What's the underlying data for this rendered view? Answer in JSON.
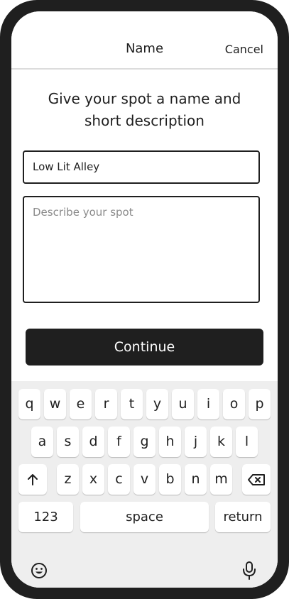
{
  "navbar": {
    "title": "Name",
    "cancel_label": "Cancel"
  },
  "form": {
    "heading_line1": "Give your spot a name and",
    "heading_line2": "short description",
    "name_value": "Low Lit Alley",
    "description_placeholder": "Describe your spot",
    "continue_label": "Continue"
  },
  "keyboard": {
    "row1": [
      "q",
      "w",
      "e",
      "r",
      "t",
      "y",
      "u",
      "i",
      "o",
      "p"
    ],
    "row2": [
      "a",
      "s",
      "d",
      "f",
      "g",
      "h",
      "j",
      "k",
      "l"
    ],
    "row3": [
      "z",
      "x",
      "c",
      "v",
      "b",
      "n",
      "m"
    ],
    "shift_icon": "shift-arrow-icon",
    "backspace_icon": "backspace-icon",
    "numbers_label": "123",
    "space_label": "space",
    "return_label": "return",
    "emoji_icon": "emoji-icon",
    "mic_icon": "microphone-icon"
  },
  "colors": {
    "ink": "#1f1f1f",
    "keyboard_bg": "#eeeeee",
    "placeholder": "#8a8a8a"
  }
}
